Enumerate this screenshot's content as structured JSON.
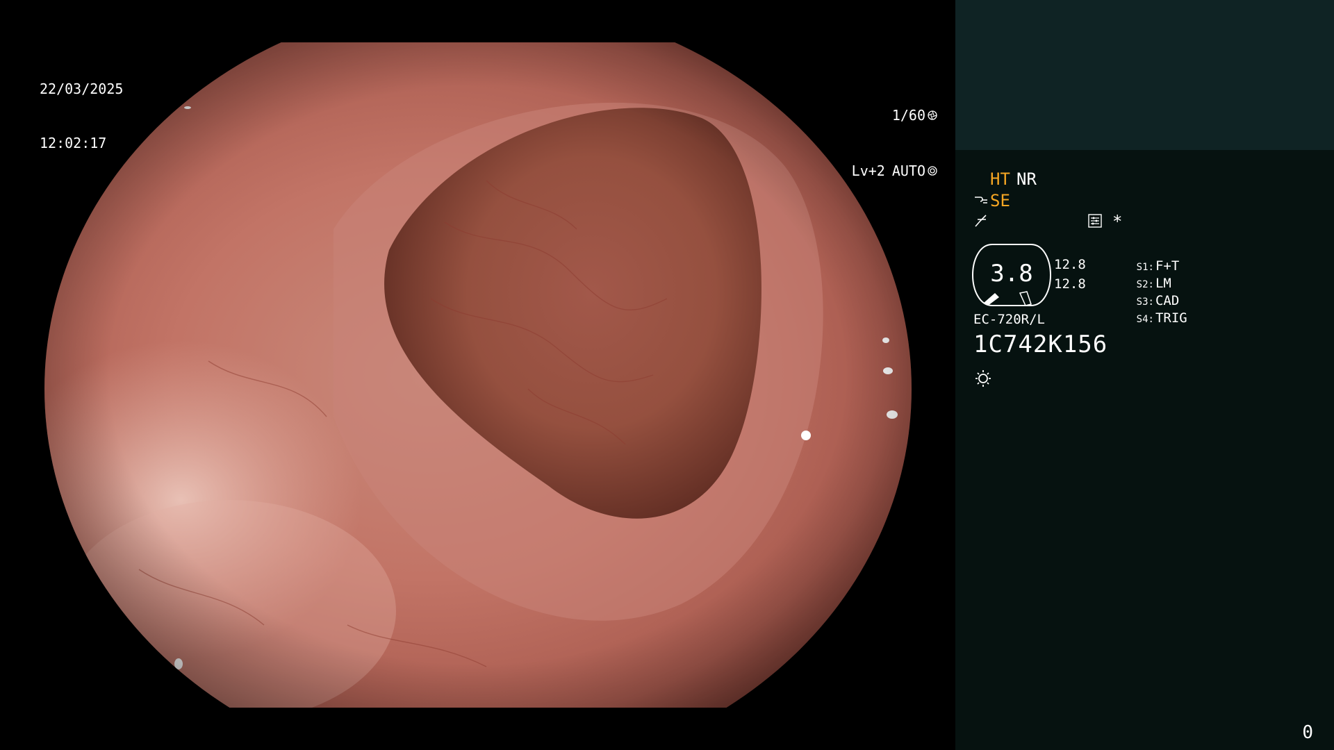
{
  "osd": {
    "date": "22/03/2025",
    "time": "12:02:17",
    "shutter": "1/60",
    "level": "Lv+2",
    "iris_mode": "AUTO"
  },
  "panel": {
    "ht": "HT",
    "nr": "NR",
    "se": "SE",
    "asterisk": "*",
    "gauge_value": "3.8",
    "value_upper": "12.8",
    "value_lower": "12.8",
    "switches": [
      {
        "key": "S1:",
        "label": "F+T"
      },
      {
        "key": "S2:",
        "label": "LM"
      },
      {
        "key": "S3:",
        "label": "CAD"
      },
      {
        "key": "S4:",
        "label": "TRIG"
      }
    ],
    "scope_model": "EC-720R/L",
    "scope_serial": "1C742K156",
    "page_counter": "0"
  },
  "icons": {
    "shutter": "aperture-icon",
    "iris": "iris-icon",
    "hook": "hook-icon",
    "curve": "curve-icon",
    "memory": "memory-icon",
    "light": "light-icon"
  },
  "colors": {
    "panel_bg": "#061210",
    "panel_header_bg": "#0f2324",
    "accent_orange": "#f5a623",
    "mucosa": "#c27466"
  }
}
